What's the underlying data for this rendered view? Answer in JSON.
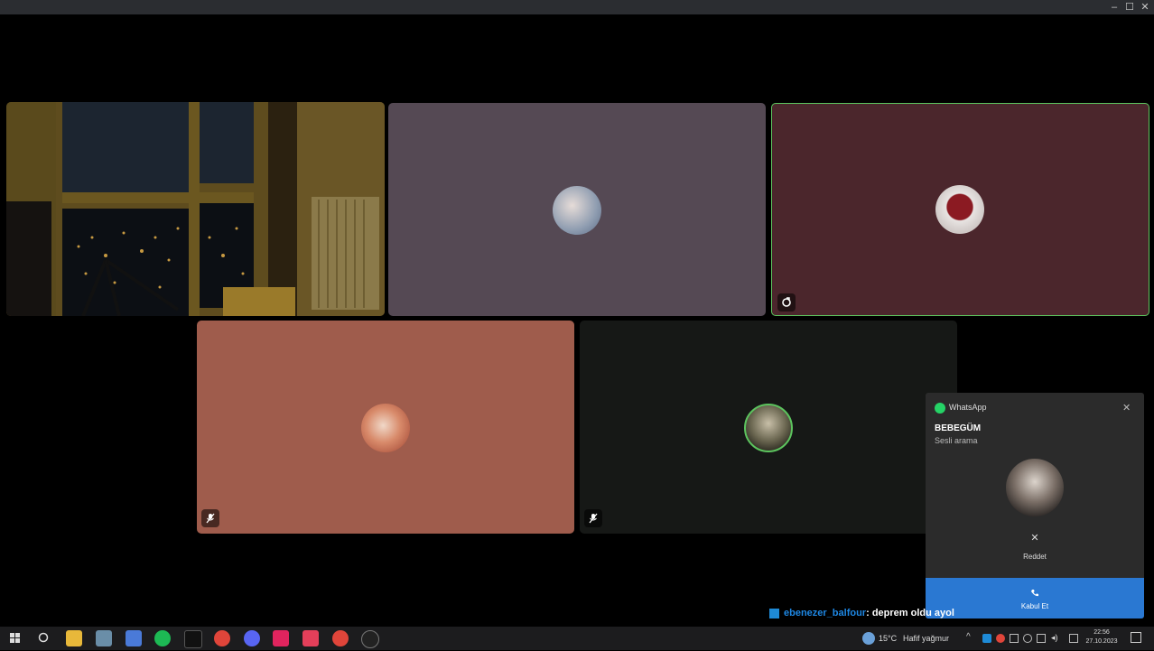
{
  "window": {
    "minimize_glyph": "–",
    "maximize_glyph": "☐",
    "close_glyph": "✕"
  },
  "chat_overlay": {
    "username": "ebenezer_balfour",
    "message": ": deprem oldu ayol"
  },
  "notification": {
    "app_name": "WhatsApp",
    "caller": "BEBEGÜM",
    "call_type": "Sesli arama",
    "decline_label": "Reddet",
    "accept_label": "Kabul Et",
    "close_glyph": "✕",
    "decline_glyph": "✕"
  },
  "taskbar": {
    "weather": "15°C",
    "weather_desc": "Hafif yağmur",
    "time": "22:56",
    "date": "27.10.2023"
  },
  "colors": {
    "tile_mauve": "#554954",
    "tile_maroon": "#4b262c",
    "tile_salmon": "#9f5c4c",
    "tile_dark": "#161816",
    "speaking_border": "#5cc45e",
    "accept_blue": "#2a78d2"
  }
}
